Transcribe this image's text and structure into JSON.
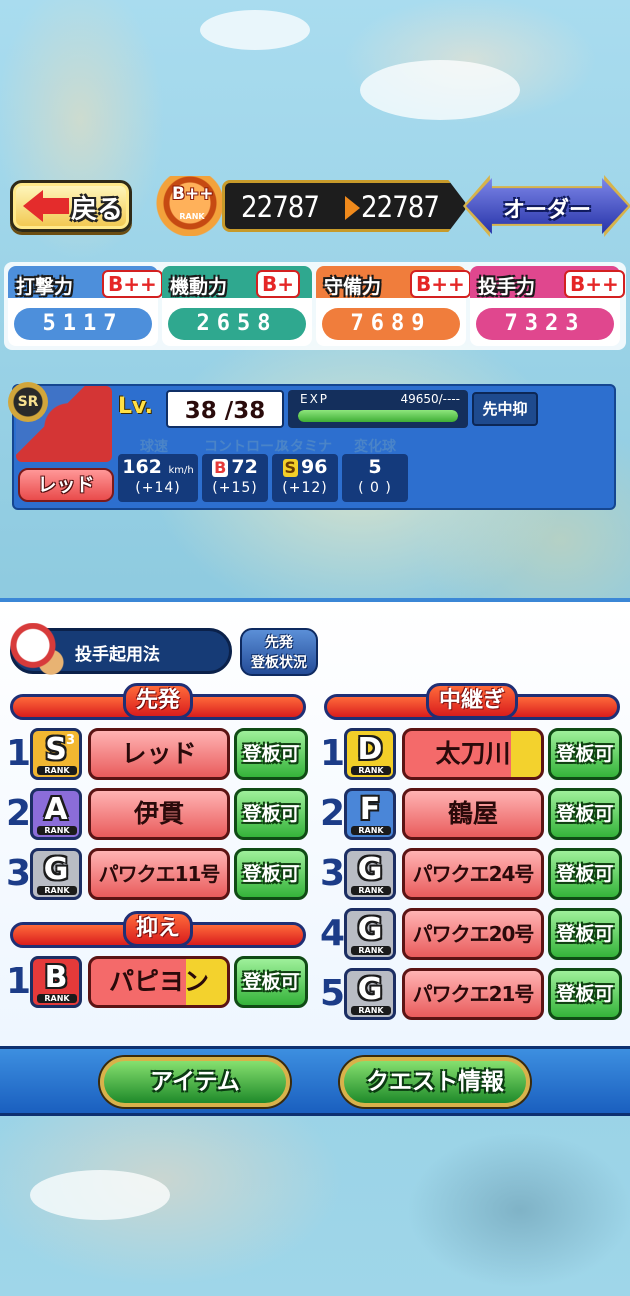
{
  "header": {
    "back_label": "戻る",
    "team_rank": "B++",
    "team_rank_sub": "RANK",
    "power_before": "22787",
    "power_after": "22787",
    "order_label": "オーダー"
  },
  "team_stats": [
    {
      "label": "打撃力",
      "grade": "B++",
      "value": "5117",
      "color": "#4d8fdb"
    },
    {
      "label": "機動力",
      "grade": "B+",
      "value": "2658",
      "color": "#2fa88f"
    },
    {
      "label": "守備力",
      "grade": "B++",
      "value": "7689",
      "color": "#f07d3c"
    },
    {
      "label": "投手力",
      "grade": "B++",
      "value": "7323",
      "color": "#e0478e"
    }
  ],
  "player_card": {
    "rarity": "SR",
    "name": "レッド",
    "level_label": "Lv.",
    "level": "38 /38",
    "exp_label": "EXP",
    "exp_value": "49650/----",
    "exp_fill": 1.0,
    "position": "先中抑",
    "abilities": [
      {
        "head": "球速",
        "grade": "",
        "main": "162",
        "unit": "km/h",
        "sub": "(+14)"
      },
      {
        "head": "コントロール",
        "grade": "B",
        "main": "72",
        "unit": "",
        "sub": "(+15)"
      },
      {
        "head": "スタミナ",
        "grade": "S",
        "main": "96",
        "unit": "",
        "sub": "(+12)"
      },
      {
        "head": "変化球",
        "grade": "",
        "main": "5",
        "unit": "",
        "sub": "( 0 )"
      }
    ]
  },
  "lineup": {
    "usage_label": "投手起用法",
    "status_label_1": "先発",
    "status_label_2": "登板状況",
    "ok_label": "登板可",
    "rank_sub": "RANK",
    "starters_title": "先発",
    "relief_title": "中継ぎ",
    "closer_title": "抑え",
    "starters": [
      {
        "num": "1",
        "rank": "S",
        "rank_level": "3",
        "name": "レッド"
      },
      {
        "num": "2",
        "rank": "A",
        "rank_level": "",
        "name": "伊貫"
      },
      {
        "num": "3",
        "rank": "G",
        "rank_level": "",
        "name": "パワクエ11号"
      }
    ],
    "closers": [
      {
        "num": "1",
        "rank": "B",
        "rank_level": "",
        "name": "パピヨン"
      }
    ],
    "relievers": [
      {
        "num": "1",
        "rank": "D",
        "rank_level": "",
        "name": "太刀川"
      },
      {
        "num": "2",
        "rank": "F",
        "rank_level": "",
        "name": "鶴屋"
      },
      {
        "num": "3",
        "rank": "G",
        "rank_level": "",
        "name": "パワクエ24号"
      },
      {
        "num": "4",
        "rank": "G",
        "rank_level": "",
        "name": "パワクエ20号"
      },
      {
        "num": "5",
        "rank": "G",
        "rank_level": "",
        "name": "パワクエ21号"
      }
    ]
  },
  "actions": {
    "item_label": "アイテム",
    "quest_label": "クエスト情報"
  },
  "rank_colors": {
    "S": "#f2b731",
    "A": "#8b6dd9",
    "B": "#e53a3a",
    "D": "#f3cf28",
    "F": "#4a86d8",
    "G": "#b9bcc4"
  }
}
